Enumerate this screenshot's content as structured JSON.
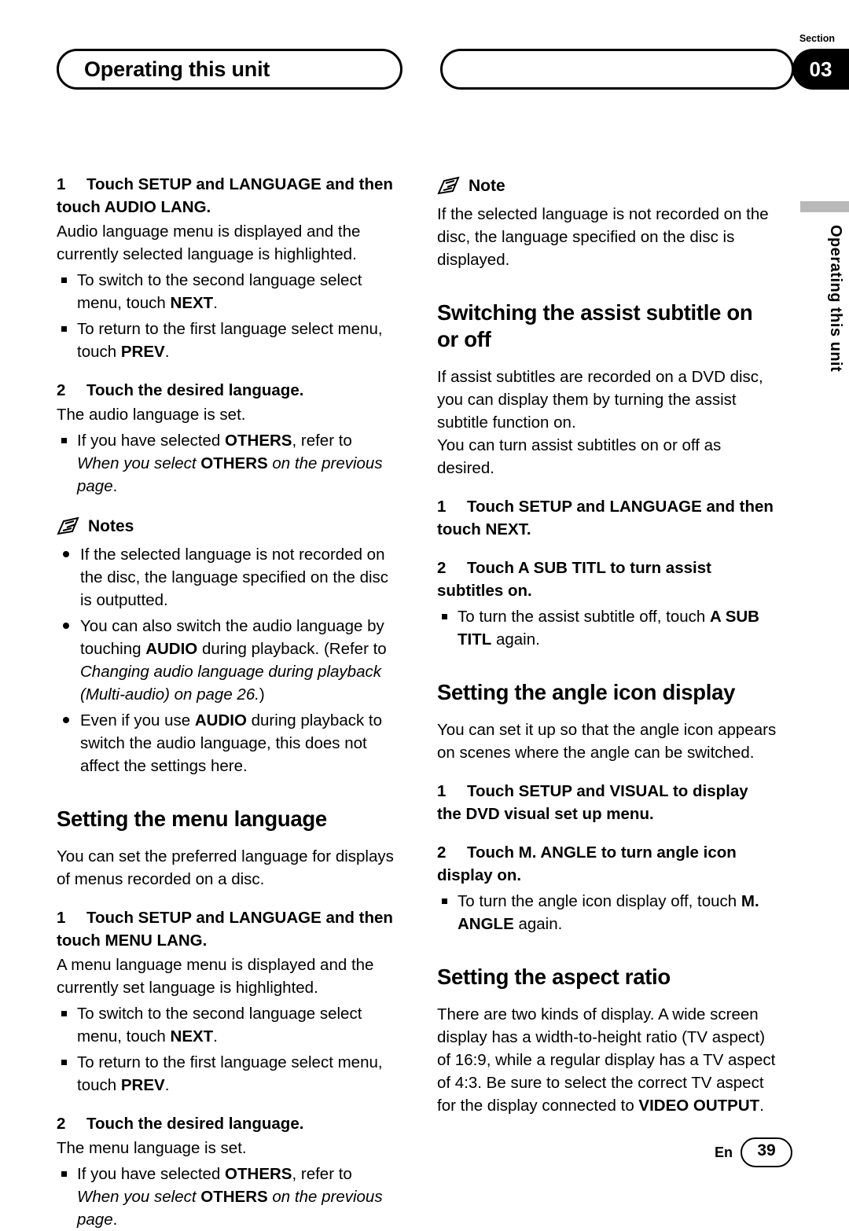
{
  "header": {
    "title": "Operating this unit",
    "section_label": "Section",
    "section_number": "03"
  },
  "side_tab": {
    "text": "Operating this unit"
  },
  "left_column": [
    {
      "kind": "step",
      "num": "1",
      "text": "Touch SETUP and LANGUAGE and then touch AUDIO LANG."
    },
    {
      "kind": "body",
      "text": "Audio language menu is displayed and the currently selected language is highlighted."
    },
    {
      "kind": "square-bullet",
      "html": "To switch to the second language select menu, touch <b>NEXT</b>."
    },
    {
      "kind": "square-bullet",
      "html": "To return to the first language select menu, touch <b>PREV</b>."
    },
    {
      "kind": "step",
      "num": "2",
      "text": "Touch the desired language."
    },
    {
      "kind": "body",
      "text": "The audio language is set."
    },
    {
      "kind": "square-bullet",
      "html": "If you have selected <b>OTHERS</b>, refer to <i>When you select</i> <b>OTHERS</b> <i>on the previous page</i>."
    },
    {
      "kind": "note-head",
      "title": "Notes"
    },
    {
      "kind": "round-bullet",
      "html": "If the selected language is not recorded on the disc, the language specified on the disc is outputted."
    },
    {
      "kind": "round-bullet",
      "html": "You can also switch the audio language by touching <b>AUDIO</b> during playback. (Refer to <i>Changing audio language during playback (Multi-audio) on page 26.</i>)"
    },
    {
      "kind": "round-bullet",
      "html": "Even if you use <b>AUDIO</b> during playback to switch the audio language, this does not affect the settings here."
    },
    {
      "kind": "heading",
      "text": "Setting the menu language"
    },
    {
      "kind": "body",
      "text": "You can set the preferred language for displays of menus recorded on a disc."
    },
    {
      "kind": "step",
      "num": "1",
      "text": "Touch SETUP and LANGUAGE and then touch MENU LANG."
    },
    {
      "kind": "body",
      "text": "A menu language menu is displayed and the currently set language is highlighted."
    },
    {
      "kind": "square-bullet",
      "html": "To switch to the second language select menu, touch <b>NEXT</b>."
    },
    {
      "kind": "square-bullet",
      "html": "To return to the first language select menu, touch <b>PREV</b>."
    },
    {
      "kind": "step",
      "num": "2",
      "text": "Touch the desired language."
    },
    {
      "kind": "body",
      "text": "The menu language is set."
    },
    {
      "kind": "square-bullet",
      "html": "If you have selected <b>OTHERS</b>, refer to <i>When you select</i> <b>OTHERS</b> <i>on the previous page</i>."
    }
  ],
  "right_column": [
    {
      "kind": "note-head",
      "title": "Note"
    },
    {
      "kind": "body",
      "text": "If the selected language is not recorded on the disc, the language specified on the disc is displayed."
    },
    {
      "kind": "heading",
      "text": "Switching the assist subtitle on or off"
    },
    {
      "kind": "body",
      "text": "If assist subtitles are recorded on a DVD disc, you can display them by turning the assist subtitle function on."
    },
    {
      "kind": "body",
      "text": "You can turn assist subtitles on or off as desired."
    },
    {
      "kind": "step",
      "num": "1",
      "text": "Touch SETUP and LANGUAGE and then touch NEXT."
    },
    {
      "kind": "step",
      "num": "2",
      "text": "Touch A SUB TITL to turn assist subtitles on."
    },
    {
      "kind": "square-bullet",
      "html": "To turn the assist subtitle off, touch <b>A SUB TITL</b> again."
    },
    {
      "kind": "heading",
      "text": "Setting the angle icon display"
    },
    {
      "kind": "body",
      "text": "You can set it up so that the angle icon appears on scenes where the angle can be switched."
    },
    {
      "kind": "step",
      "num": "1",
      "text": "Touch SETUP and VISUAL to display the DVD visual set up menu."
    },
    {
      "kind": "step",
      "num": "2",
      "text": "Touch M. ANGLE to turn angle icon display on."
    },
    {
      "kind": "square-bullet",
      "html": "To turn the angle icon display off, touch <b>M. ANGLE</b> again."
    },
    {
      "kind": "heading",
      "text": "Setting the aspect ratio"
    },
    {
      "kind": "body",
      "html": "There are two kinds of display. A wide screen display has a width-to-height ratio (TV aspect) of 16:9, while a regular display has a TV aspect of 4:3. Be sure to select the correct TV aspect for the display connected to <b>VIDEO OUTPUT</b>."
    }
  ],
  "footer": {
    "lang": "En",
    "page": "39"
  }
}
